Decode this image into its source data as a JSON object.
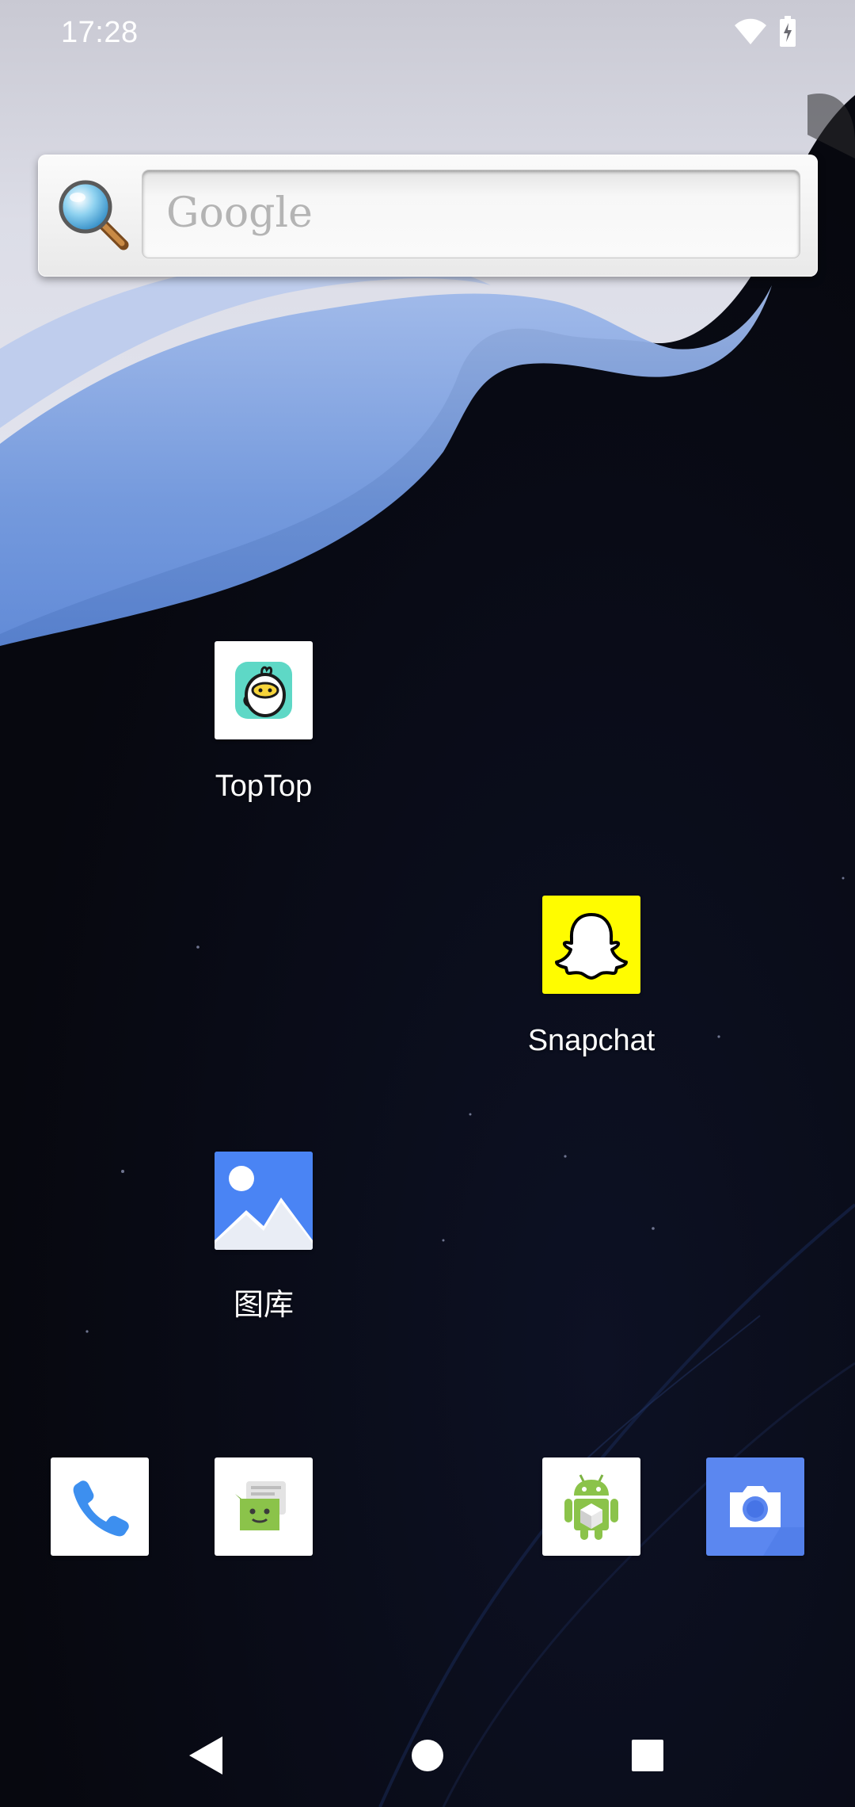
{
  "status_bar": {
    "time": "17:28",
    "icons": [
      "wifi-icon",
      "battery-charging-icon"
    ]
  },
  "search_widget": {
    "placeholder": "Google",
    "icon": "magnifier-icon"
  },
  "apps": [
    {
      "label": "TopTop",
      "icon": "toptop-icon"
    },
    {
      "label": "Snapchat",
      "icon": "snapchat-ghost-icon",
      "color": "#FFFC00"
    },
    {
      "label": "图库",
      "icon": "gallery-icon",
      "color": "#4A84F4"
    }
  ],
  "dock": [
    {
      "icon": "phone-icon"
    },
    {
      "icon": "messaging-icon"
    },
    {
      "icon": "android-app-icon"
    },
    {
      "icon": "camera-icon",
      "color": "#5B87F0"
    }
  ],
  "nav_bar": {
    "icons": [
      "back-icon",
      "home-icon",
      "recents-icon"
    ]
  }
}
